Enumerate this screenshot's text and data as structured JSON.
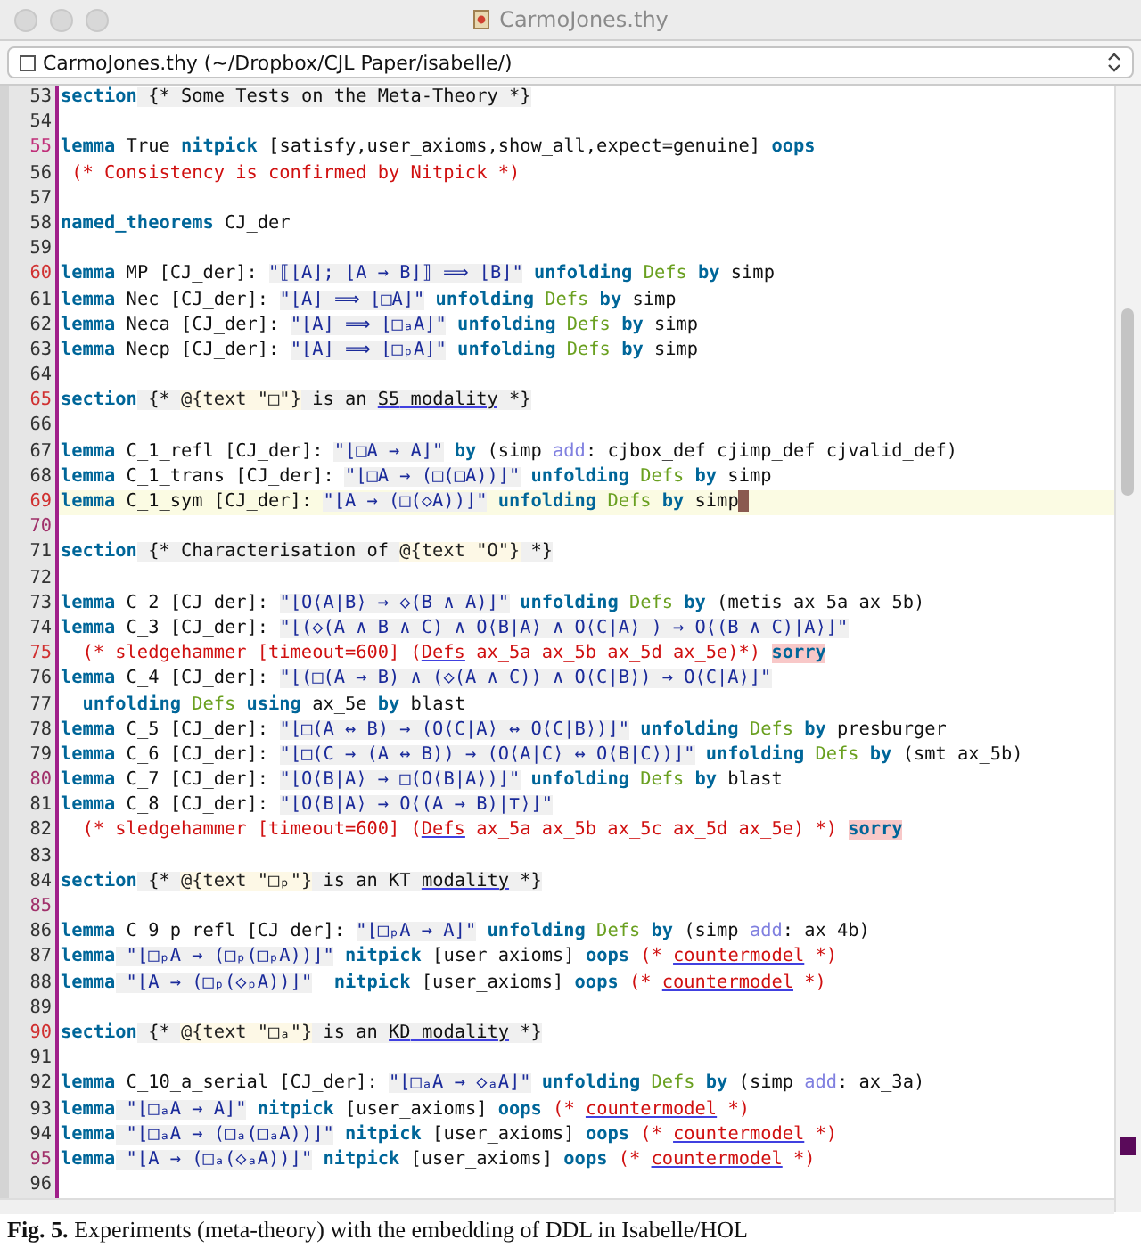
{
  "window": {
    "title": "CarmoJones.thy"
  },
  "buffer_selector": {
    "label": "CarmoJones.thy (~/Dropbox/CJL Paper/isabelle/)"
  },
  "lines": [
    {
      "number": "53",
      "current": false,
      "segments": [
        {
          "kind": "cmd",
          "text": "section"
        },
        {
          "kind": "cart",
          "text": " {* Some Tests on the Meta-Theory *}"
        }
      ]
    },
    {
      "number": "54",
      "current": false
    },
    {
      "number": "55",
      "current": false,
      "color": "#c0307a",
      "segments": [
        {
          "kind": "cmd",
          "text": "lemma"
        },
        {
          "kind": "plain",
          "text": " True "
        },
        {
          "kind": "kw",
          "text": "nitpick"
        },
        {
          "kind": "plain",
          "text": " [satisfy,user_axioms,show_all,expect=genuine] "
        },
        {
          "kind": "kw",
          "text": "oops"
        }
      ]
    },
    {
      "number": "56",
      "current": false,
      "segments": [
        {
          "kind": "comment",
          "text": " (* Consistency is confirmed by Nitpick *)"
        }
      ]
    },
    {
      "number": "57",
      "current": false
    },
    {
      "number": "58",
      "current": false,
      "segments": [
        {
          "kind": "cmd",
          "text": "named_theorems"
        },
        {
          "kind": "plain",
          "text": " CJ_der"
        }
      ]
    },
    {
      "number": "59",
      "current": false
    },
    {
      "number": "60",
      "current": false,
      "color": "#d03030",
      "segments": [
        {
          "kind": "cmd",
          "text": "lemma"
        },
        {
          "kind": "plain",
          "text": " MP [CJ_der]: "
        },
        {
          "kind": "str",
          "text": "\"⟦⌊A⌋; ⌊A → B⌋⟧ ⟹ ⌊B⌋\""
        },
        {
          "kind": "kw",
          "text": " unfolding"
        },
        {
          "kind": "fact",
          "text": " Defs"
        },
        {
          "kind": "kw",
          "text": " by"
        },
        {
          "kind": "plain",
          "text": " simp"
        }
      ]
    },
    {
      "number": "61",
      "current": false,
      "segments": [
        {
          "kind": "cmd",
          "text": "lemma"
        },
        {
          "kind": "plain",
          "text": " Nec [CJ_der]: "
        },
        {
          "kind": "str",
          "text": "\"⌊A⌋ ⟹ ⌊□A⌋\""
        },
        {
          "kind": "kw",
          "text": " unfolding"
        },
        {
          "kind": "fact",
          "text": " Defs"
        },
        {
          "kind": "kw",
          "text": " by"
        },
        {
          "kind": "plain",
          "text": " simp"
        }
      ]
    },
    {
      "number": "62",
      "current": false,
      "segments": [
        {
          "kind": "cmd",
          "text": "lemma"
        },
        {
          "kind": "plain",
          "text": " Neca [CJ_der]: "
        },
        {
          "kind": "str",
          "text": "\"⌊A⌋ ⟹ ⌊□ₐA⌋\""
        },
        {
          "kind": "kw",
          "text": " unfolding"
        },
        {
          "kind": "fact",
          "text": " Defs"
        },
        {
          "kind": "kw",
          "text": " by"
        },
        {
          "kind": "plain",
          "text": " simp"
        }
      ]
    },
    {
      "number": "63",
      "current": false,
      "segments": [
        {
          "kind": "cmd",
          "text": "lemma"
        },
        {
          "kind": "plain",
          "text": " Necp [CJ_der]: "
        },
        {
          "kind": "str",
          "text": "\"⌊A⌋ ⟹ ⌊□ₚA⌋\""
        },
        {
          "kind": "kw",
          "text": " unfolding"
        },
        {
          "kind": "fact",
          "text": " Defs"
        },
        {
          "kind": "kw",
          "text": " by"
        },
        {
          "kind": "plain",
          "text": " simp"
        }
      ]
    },
    {
      "number": "64",
      "current": false
    },
    {
      "number": "65",
      "current": false,
      "color": "#d03030",
      "segments": [
        {
          "kind": "cmd",
          "text": "section"
        },
        {
          "kind": "cart",
          "text": " {* "
        },
        {
          "kind": "anti",
          "text": "@{text \"□\"}"
        },
        {
          "kind": "cart",
          "text": " is an "
        },
        {
          "kind": "ul",
          "text": "S5"
        },
        {
          "kind": "ul",
          "text": " modality"
        },
        {
          "kind": "cart",
          "text": " *}"
        }
      ]
    },
    {
      "number": "66",
      "current": false
    },
    {
      "number": "67",
      "current": false,
      "segments": [
        {
          "kind": "cmd",
          "text": "lemma"
        },
        {
          "kind": "plain",
          "text": " C_1_refl [CJ_der]: "
        },
        {
          "kind": "str",
          "text": "\"⌊□A → A⌋\""
        },
        {
          "kind": "kw",
          "text": " by"
        },
        {
          "kind": "plain",
          "text": " (simp "
        },
        {
          "kind": "attr",
          "text": "add"
        },
        {
          "kind": "plain",
          "text": ": cjbox_def cjimp_def cjvalid_def)"
        }
      ]
    },
    {
      "number": "68",
      "current": false,
      "segments": [
        {
          "kind": "cmd",
          "text": "lemma"
        },
        {
          "kind": "plain",
          "text": " C_1_trans [CJ_der]: "
        },
        {
          "kind": "str",
          "text": "\"⌊□A → (□(□A))⌋\""
        },
        {
          "kind": "kw",
          "text": " unfolding"
        },
        {
          "kind": "fact",
          "text": " Defs"
        },
        {
          "kind": "kw",
          "text": " by"
        },
        {
          "kind": "plain",
          "text": " simp"
        }
      ]
    },
    {
      "number": "69",
      "current": true,
      "color": "#d03030",
      "segments": [
        {
          "kind": "cmd",
          "text": "lemma"
        },
        {
          "kind": "plain",
          "text": " C_1_sym [CJ_der]: "
        },
        {
          "kind": "str",
          "text": "\"⌊A → (□(◇A))⌋\""
        },
        {
          "kind": "kw",
          "text": " unfolding"
        },
        {
          "kind": "fact",
          "text": " Defs"
        },
        {
          "kind": "kw",
          "text": " by"
        },
        {
          "kind": "plain",
          "text": " simp"
        }
      ]
    },
    {
      "number": "70",
      "current": false,
      "color": "#a0306a"
    },
    {
      "number": "71",
      "current": false,
      "segments": [
        {
          "kind": "cmd",
          "text": "section"
        },
        {
          "kind": "cart",
          "text": " {* Characterisation of "
        },
        {
          "kind": "anti",
          "text": "@{text \"O\"}"
        },
        {
          "kind": "cart",
          "text": " *}"
        }
      ]
    },
    {
      "number": "72",
      "current": false
    },
    {
      "number": "73",
      "current": false,
      "segments": [
        {
          "kind": "cmd",
          "text": "lemma"
        },
        {
          "kind": "plain",
          "text": " C_2 [CJ_der]: "
        },
        {
          "kind": "str",
          "text": "\"⌊O⟨A|B⟩ → ◇(B ∧ A)⌋\""
        },
        {
          "kind": "kw",
          "text": " unfolding"
        },
        {
          "kind": "fact",
          "text": " Defs"
        },
        {
          "kind": "kw",
          "text": " by"
        },
        {
          "kind": "plain",
          "text": " (metis ax_5a ax_5b)"
        }
      ]
    },
    {
      "number": "74",
      "current": false,
      "segments": [
        {
          "kind": "cmd",
          "text": "lemma"
        },
        {
          "kind": "plain",
          "text": " C_3 [CJ_der]: "
        },
        {
          "kind": "str",
          "text": "\"⌊(◇(A ∧ B ∧ C) ∧ O⟨B|A⟩ ∧ O⟨C|A⟩ ) → O⟨(B ∧ C)|A⟩⌋\""
        }
      ]
    },
    {
      "number": "75",
      "current": false,
      "color": "#d03030",
      "segments": [
        {
          "kind": "comment",
          "text": "  (* sledgehammer [timeout=600] ("
        },
        {
          "kind": "err",
          "text": "Defs"
        },
        {
          "kind": "comment",
          "text": " ax_5a ax_5b ax_5d ax_5e)*) "
        },
        {
          "kind": "sorry",
          "text": "sorry"
        }
      ]
    },
    {
      "number": "76",
      "current": false,
      "segments": [
        {
          "kind": "cmd",
          "text": "lemma"
        },
        {
          "kind": "plain",
          "text": " C_4 [CJ_der]: "
        },
        {
          "kind": "str",
          "text": "\"⌊(□(A → B) ∧ (◇(A ∧ C)) ∧ O⟨C|B⟩) → O⟨C|A⟩⌋\""
        }
      ]
    },
    {
      "number": "77",
      "current": false,
      "segments": [
        {
          "kind": "kw",
          "text": "  unfolding"
        },
        {
          "kind": "fact",
          "text": " Defs"
        },
        {
          "kind": "kw",
          "text": " using"
        },
        {
          "kind": "plain",
          "text": " ax_5e "
        },
        {
          "kind": "kw",
          "text": "by"
        },
        {
          "kind": "plain",
          "text": " blast"
        }
      ]
    },
    {
      "number": "78",
      "current": false,
      "segments": [
        {
          "kind": "cmd",
          "text": "lemma"
        },
        {
          "kind": "plain",
          "text": " C_5 [CJ_der]: "
        },
        {
          "kind": "str",
          "text": "\"⌊□(A ↔ B) → (O⟨C|A⟩ ↔ O⟨C|B⟩)⌋\""
        },
        {
          "kind": "kw",
          "text": " unfolding"
        },
        {
          "kind": "fact",
          "text": " Defs"
        },
        {
          "kind": "kw",
          "text": " by"
        },
        {
          "kind": "plain",
          "text": " presburger"
        }
      ]
    },
    {
      "number": "79",
      "current": false,
      "segments": [
        {
          "kind": "cmd",
          "text": "lemma"
        },
        {
          "kind": "plain",
          "text": " C_6 [CJ_der]: "
        },
        {
          "kind": "str",
          "text": "\"⌊□(C → (A ↔ B)) → (O⟨A|C⟩ ↔ O⟨B|C⟩)⌋\""
        },
        {
          "kind": "kw",
          "text": " unfolding"
        },
        {
          "kind": "fact",
          "text": " Defs"
        },
        {
          "kind": "kw",
          "text": " by"
        },
        {
          "kind": "plain",
          "text": " (smt ax_5b)"
        }
      ]
    },
    {
      "number": "80",
      "current": false,
      "color": "#a0306a",
      "segments": [
        {
          "kind": "cmd",
          "text": "lemma"
        },
        {
          "kind": "plain",
          "text": " C_7 [CJ_der]: "
        },
        {
          "kind": "str",
          "text": "\"⌊O⟨B|A⟩ → □(O⟨B|A⟩)⌋\""
        },
        {
          "kind": "kw",
          "text": " unfolding"
        },
        {
          "kind": "fact",
          "text": " Defs"
        },
        {
          "kind": "kw",
          "text": " by"
        },
        {
          "kind": "plain",
          "text": " blast"
        }
      ]
    },
    {
      "number": "81",
      "current": false,
      "segments": [
        {
          "kind": "cmd",
          "text": "lemma"
        },
        {
          "kind": "plain",
          "text": " C_8 [CJ_der]: "
        },
        {
          "kind": "str",
          "text": "\"⌊O⟨B|A⟩ → O⟨(A → B)|⊤⟩⌋\""
        }
      ]
    },
    {
      "number": "82",
      "current": false,
      "segments": [
        {
          "kind": "comment",
          "text": "  (* sledgehammer [timeout=600] ("
        },
        {
          "kind": "err",
          "text": "Defs"
        },
        {
          "kind": "comment",
          "text": " ax_5a ax_5b ax_5c ax_5d ax_5e) *) "
        },
        {
          "kind": "sorry",
          "text": "sorry"
        }
      ]
    },
    {
      "number": "83",
      "current": false
    },
    {
      "number": "84",
      "current": false,
      "segments": [
        {
          "kind": "cmd",
          "text": "section"
        },
        {
          "kind": "cart",
          "text": " {* "
        },
        {
          "kind": "anti",
          "text": "@{text \"□ₚ\"}"
        },
        {
          "kind": "cart",
          "text": " is an KT "
        },
        {
          "kind": "ul",
          "text": "modality"
        },
        {
          "kind": "cart",
          "text": " *}"
        }
      ]
    },
    {
      "number": "85",
      "current": false,
      "color": "#a0306a"
    },
    {
      "number": "86",
      "current": false,
      "segments": [
        {
          "kind": "cmd",
          "text": "lemma"
        },
        {
          "kind": "plain",
          "text": " C_9_p_refl [CJ_der]: "
        },
        {
          "kind": "str",
          "text": "\"⌊□ₚA → A⌋\""
        },
        {
          "kind": "kw",
          "text": " unfolding"
        },
        {
          "kind": "fact",
          "text": " Defs"
        },
        {
          "kind": "kw",
          "text": " by"
        },
        {
          "kind": "plain",
          "text": " (simp "
        },
        {
          "kind": "attr",
          "text": "add"
        },
        {
          "kind": "plain",
          "text": ": ax_4b)"
        }
      ]
    },
    {
      "number": "87",
      "current": false,
      "segments": [
        {
          "kind": "cmd",
          "text": "lemma"
        },
        {
          "kind": "str",
          "text": " \"⌊□ₚA → (□ₚ(□ₚA))⌋\""
        },
        {
          "kind": "kw",
          "text": " nitpick"
        },
        {
          "kind": "plain",
          "text": " [user_axioms] "
        },
        {
          "kind": "kw",
          "text": "oops"
        },
        {
          "kind": "comment",
          "text": " (* "
        },
        {
          "kind": "err",
          "text": "countermodel"
        },
        {
          "kind": "comment",
          "text": " *)"
        }
      ]
    },
    {
      "number": "88",
      "current": false,
      "segments": [
        {
          "kind": "cmd",
          "text": "lemma"
        },
        {
          "kind": "str",
          "text": " \"⌊A → (□ₚ(◇ₚA))⌋\""
        },
        {
          "kind": "kw",
          "text": "  nitpick"
        },
        {
          "kind": "plain",
          "text": " [user_axioms] "
        },
        {
          "kind": "kw",
          "text": "oops"
        },
        {
          "kind": "comment",
          "text": " (* "
        },
        {
          "kind": "err",
          "text": "countermodel"
        },
        {
          "kind": "comment",
          "text": " *)"
        }
      ]
    },
    {
      "number": "89",
      "current": false
    },
    {
      "number": "90",
      "current": false,
      "color": "#d03030",
      "segments": [
        {
          "kind": "cmd",
          "text": "section"
        },
        {
          "kind": "cart",
          "text": " {* "
        },
        {
          "kind": "anti",
          "text": "@{text \"□ₐ\"}"
        },
        {
          "kind": "cart",
          "text": " is an "
        },
        {
          "kind": "ul",
          "text": "KD"
        },
        {
          "kind": "ul",
          "text": " modality"
        },
        {
          "kind": "cart",
          "text": " *}"
        }
      ]
    },
    {
      "number": "91",
      "current": false
    },
    {
      "number": "92",
      "current": false,
      "segments": [
        {
          "kind": "cmd",
          "text": "lemma"
        },
        {
          "kind": "plain",
          "text": " C_10_a_serial [CJ_der]: "
        },
        {
          "kind": "str",
          "text": "\"⌊□ₐA → ◇ₐA⌋\""
        },
        {
          "kind": "kw",
          "text": " unfolding"
        },
        {
          "kind": "fact",
          "text": " Defs"
        },
        {
          "kind": "kw",
          "text": " by"
        },
        {
          "kind": "plain",
          "text": " (simp "
        },
        {
          "kind": "attr",
          "text": "add"
        },
        {
          "kind": "plain",
          "text": ": ax_3a)"
        }
      ]
    },
    {
      "number": "93",
      "current": false,
      "segments": [
        {
          "kind": "cmd",
          "text": "lemma"
        },
        {
          "kind": "str",
          "text": " \"⌊□ₐA → A⌋\""
        },
        {
          "kind": "kw",
          "text": " nitpick"
        },
        {
          "kind": "plain",
          "text": " [user_axioms] "
        },
        {
          "kind": "kw",
          "text": "oops"
        },
        {
          "kind": "comment",
          "text": " (* "
        },
        {
          "kind": "err",
          "text": "countermodel"
        },
        {
          "kind": "comment",
          "text": " *)"
        }
      ]
    },
    {
      "number": "94",
      "current": false,
      "segments": [
        {
          "kind": "cmd",
          "text": "lemma"
        },
        {
          "kind": "str",
          "text": " \"⌊□ₐA → (□ₐ(□ₐA))⌋\""
        },
        {
          "kind": "kw",
          "text": " nitpick"
        },
        {
          "kind": "plain",
          "text": " [user_axioms] "
        },
        {
          "kind": "kw",
          "text": "oops"
        },
        {
          "kind": "comment",
          "text": " (* "
        },
        {
          "kind": "err",
          "text": "countermodel"
        },
        {
          "kind": "comment",
          "text": " *)"
        }
      ]
    },
    {
      "number": "95",
      "current": false,
      "color": "#a0306a",
      "segments": [
        {
          "kind": "cmd",
          "text": "lemma"
        },
        {
          "kind": "str",
          "text": " \"⌊A → (□ₐ(◇ₐA))⌋\""
        },
        {
          "kind": "kw",
          "text": " nitpick"
        },
        {
          "kind": "plain",
          "text": " [user_axioms] "
        },
        {
          "kind": "kw",
          "text": "oops"
        },
        {
          "kind": "comment",
          "text": " (* "
        },
        {
          "kind": "err",
          "text": "countermodel"
        },
        {
          "kind": "comment",
          "text": " *)"
        }
      ]
    },
    {
      "number": "96",
      "current": false
    }
  ],
  "caption": "**Fig. 5.** Experiments (meta-theory) with the embedding of DDL in Isabelle/HOL"
}
